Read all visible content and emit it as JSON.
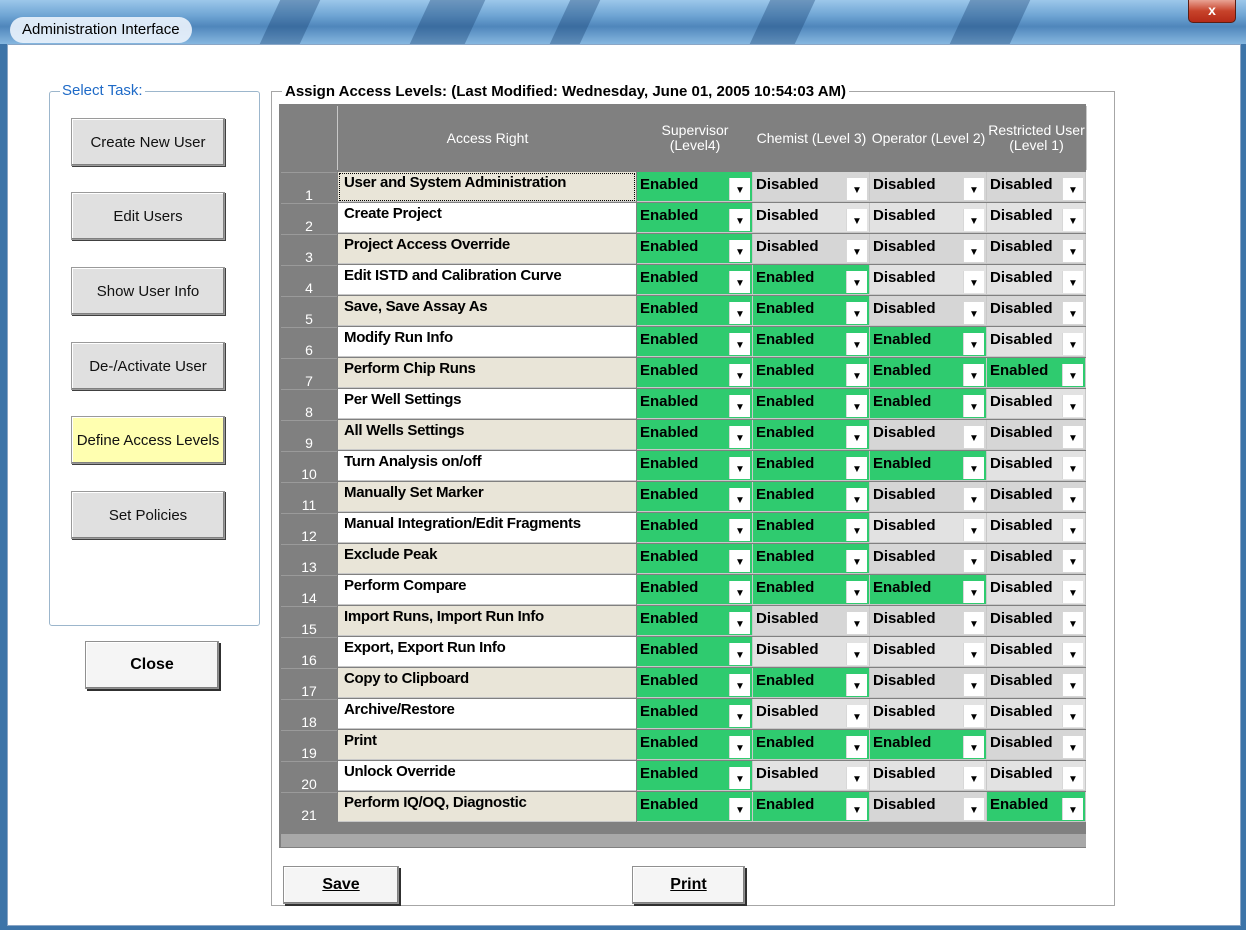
{
  "window": {
    "title": "Administration Interface",
    "close_glyph": "x"
  },
  "task_panel": {
    "legend": "Select Task:",
    "buttons": [
      {
        "label": "Create New User",
        "active": false
      },
      {
        "label": "Edit Users",
        "active": false
      },
      {
        "label": "Show User Info",
        "active": false
      },
      {
        "label": "De-/Activate User",
        "active": false
      },
      {
        "label": "Define Access Levels",
        "active": true
      },
      {
        "label": "Set Policies",
        "active": false
      }
    ]
  },
  "close_button": {
    "label": "Close"
  },
  "access_panel": {
    "legend": "Assign Access Levels: (Last Modified: Wednesday, June 01, 2005 10:54:03 AM)",
    "columns": [
      "Access Right",
      "Supervisor (Level4)",
      "Chemist (Level 3)",
      "Operator (Level 2)",
      "Restricted User (Level 1)"
    ],
    "rows": [
      {
        "num": "1",
        "right": "User and System Administration",
        "values": [
          "Enabled",
          "Disabled",
          "Disabled",
          "Disabled"
        ]
      },
      {
        "num": "2",
        "right": "Create Project",
        "values": [
          "Enabled",
          "Disabled",
          "Disabled",
          "Disabled"
        ]
      },
      {
        "num": "3",
        "right": "Project Access Override",
        "values": [
          "Enabled",
          "Disabled",
          "Disabled",
          "Disabled"
        ]
      },
      {
        "num": "4",
        "right": "Edit ISTD and Calibration Curve",
        "values": [
          "Enabled",
          "Enabled",
          "Disabled",
          "Disabled"
        ]
      },
      {
        "num": "5",
        "right": "Save, Save Assay As",
        "values": [
          "Enabled",
          "Enabled",
          "Disabled",
          "Disabled"
        ]
      },
      {
        "num": "6",
        "right": "Modify Run Info",
        "values": [
          "Enabled",
          "Enabled",
          "Enabled",
          "Disabled"
        ]
      },
      {
        "num": "7",
        "right": "Perform Chip Runs",
        "values": [
          "Enabled",
          "Enabled",
          "Enabled",
          "Enabled"
        ]
      },
      {
        "num": "8",
        "right": "Per Well Settings",
        "values": [
          "Enabled",
          "Enabled",
          "Enabled",
          "Disabled"
        ]
      },
      {
        "num": "9",
        "right": "All Wells Settings",
        "values": [
          "Enabled",
          "Enabled",
          "Disabled",
          "Disabled"
        ]
      },
      {
        "num": "10",
        "right": "Turn Analysis on/off",
        "values": [
          "Enabled",
          "Enabled",
          "Enabled",
          "Disabled"
        ]
      },
      {
        "num": "11",
        "right": "Manually Set Marker",
        "values": [
          "Enabled",
          "Enabled",
          "Disabled",
          "Disabled"
        ]
      },
      {
        "num": "12",
        "right": "Manual Integration/Edit Fragments",
        "values": [
          "Enabled",
          "Enabled",
          "Disabled",
          "Disabled"
        ]
      },
      {
        "num": "13",
        "right": "Exclude Peak",
        "values": [
          "Enabled",
          "Enabled",
          "Disabled",
          "Disabled"
        ]
      },
      {
        "num": "14",
        "right": "Perform Compare",
        "values": [
          "Enabled",
          "Enabled",
          "Enabled",
          "Disabled"
        ]
      },
      {
        "num": "15",
        "right": "Import Runs, Import Run Info",
        "values": [
          "Enabled",
          "Disabled",
          "Disabled",
          "Disabled"
        ]
      },
      {
        "num": "16",
        "right": "Export, Export Run Info",
        "values": [
          "Enabled",
          "Disabled",
          "Disabled",
          "Disabled"
        ]
      },
      {
        "num": "17",
        "right": "Copy to Clipboard",
        "values": [
          "Enabled",
          "Enabled",
          "Disabled",
          "Disabled"
        ]
      },
      {
        "num": "18",
        "right": "Archive/Restore",
        "values": [
          "Enabled",
          "Disabled",
          "Disabled",
          "Disabled"
        ]
      },
      {
        "num": "19",
        "right": "Print",
        "values": [
          "Enabled",
          "Enabled",
          "Enabled",
          "Disabled"
        ]
      },
      {
        "num": "20",
        "right": "Unlock Override",
        "values": [
          "Enabled",
          "Disabled",
          "Disabled",
          "Disabled"
        ]
      },
      {
        "num": "21",
        "right": "Perform IQ/OQ, Diagnostic",
        "values": [
          "Enabled",
          "Enabled",
          "Disabled",
          "Enabled"
        ]
      }
    ]
  },
  "save_button": {
    "label": "Save"
  },
  "print_button": {
    "label": "Print"
  },
  "colors": {
    "enabled": "#2fcb6f",
    "disabled": "#d6d6d6",
    "header": "#808080",
    "active_task": "#ffffb0"
  }
}
